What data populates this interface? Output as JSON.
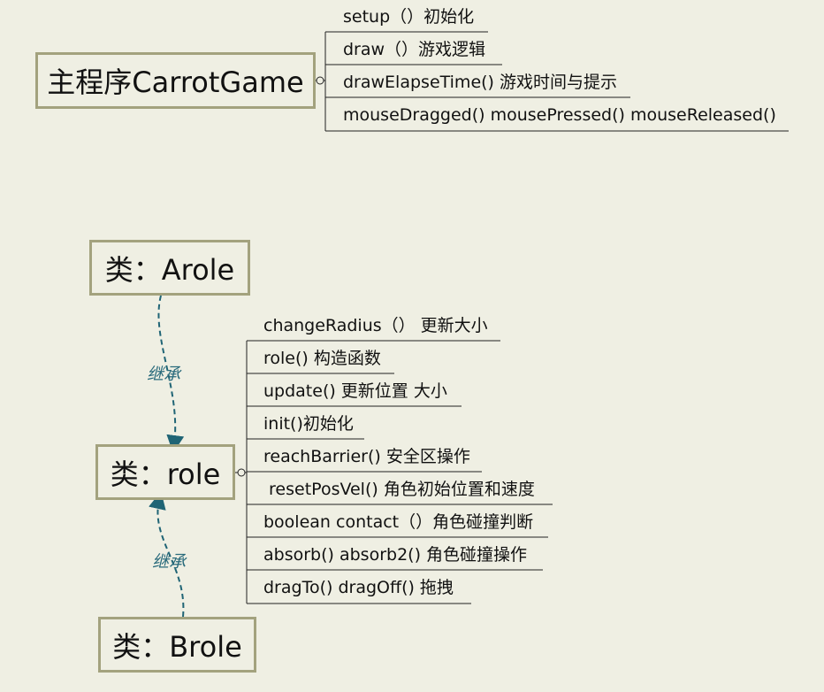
{
  "main_program": {
    "title": "主程序CarrotGame",
    "methods": [
      "setup（）初始化",
      "draw（）游戏逻辑",
      "drawElapseTime() 游戏时间与提示",
      "mouseDragged() mousePressed()  mouseReleased()"
    ]
  },
  "class_arole": {
    "title": "类：Arole"
  },
  "class_role": {
    "title": "类：role",
    "methods": [
      "changeRadius（）  更新大小",
      "role() 构造函数",
      "update() 更新位置 大小",
      "init()初始化",
      "reachBarrier() 安全区操作",
      " resetPosVel() 角色初始位置和速度",
      "boolean contact（）角色碰撞判断",
      "absorb() absorb2() 角色碰撞操作",
      "dragTo() dragOff() 拖拽"
    ]
  },
  "class_brole": {
    "title": "类：Brole"
  },
  "edges": {
    "arole_role_label": "继承",
    "brole_role_label": "继承"
  },
  "colors": {
    "background": "#efefe3",
    "box_border": "#a3a27e",
    "inherit_arrow": "#1f6475",
    "line": "#222222"
  }
}
